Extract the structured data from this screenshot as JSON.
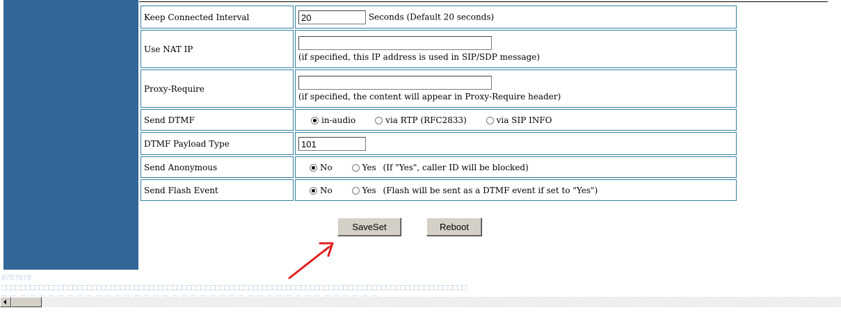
{
  "rows": {
    "keep_connected": {
      "label": "Keep Connected Interval",
      "value": "20",
      "note": "Seconds (Default 20 seconds)"
    },
    "nat_ip": {
      "label": "Use NAT IP",
      "value": "",
      "note": "(if specified, this IP address is used in SIP/SDP message)"
    },
    "proxy_require": {
      "label": "Proxy-Require",
      "value": "",
      "note": "(if specified, the content will appear in Proxy-Require header)"
    },
    "send_dtmf": {
      "label": "Send DTMF",
      "options": [
        "in-audio",
        "via RTP (RFC2833)",
        "via SIP INFO"
      ],
      "selected": "in-audio"
    },
    "dtmf_payload": {
      "label": "DTMF Payload Type",
      "value": "101"
    },
    "send_anonymous": {
      "label": "Send Anonymous",
      "options": [
        "No",
        "Yes"
      ],
      "selected": "No",
      "note": "(If \"Yes\", caller ID will be blocked)"
    },
    "send_flash": {
      "label": "Send Flash Event",
      "options": [
        "No",
        "Yes"
      ],
      "selected": "No",
      "note": "(Flash will be sent as a DTMF event if set to \"Yes\")"
    }
  },
  "buttons": {
    "save": "SaveSet",
    "reboot": "Reboot"
  },
  "footer": {
    "code": "8787878",
    "garble_line1": "□□□□□□□□□□□□□□□□□□□□□□□□□□□□□□□□□□□□□□□□□□□□□□□□□□□□□□□□□□□□□□□□□□□□□□□□□□□□□□□□□□□□□□□□□□□□□□□□□□",
    "garble_line2": "□ □ □ □ □ □ □ □ □ □ □ □ □ □ □ □ □ □ □ □ □ □ □ □ □ □ □ □ □ □ □ □ □ □ □ □ □ □ □ □"
  },
  "colors": {
    "sidebar": "#336699",
    "border": "#2f7f9f",
    "arrow": "#e02020"
  }
}
